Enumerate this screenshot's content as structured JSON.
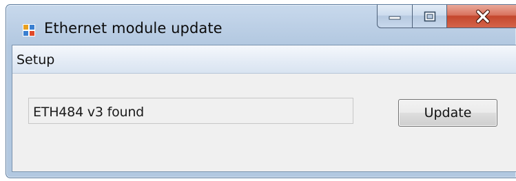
{
  "window": {
    "title": "Ethernet module update",
    "icon": "application-window-icon",
    "controls": [
      "minimize-icon",
      "maximize-icon",
      "close-icon"
    ]
  },
  "menu": {
    "items": [
      {
        "label": "Setup"
      }
    ]
  },
  "main": {
    "status_text": "ETH484 v3 found",
    "update_label": "Update"
  },
  "colors": {
    "title_bar": "#b9cde4",
    "close_button": "#c4472d",
    "client_background": "#f0f0f0"
  }
}
